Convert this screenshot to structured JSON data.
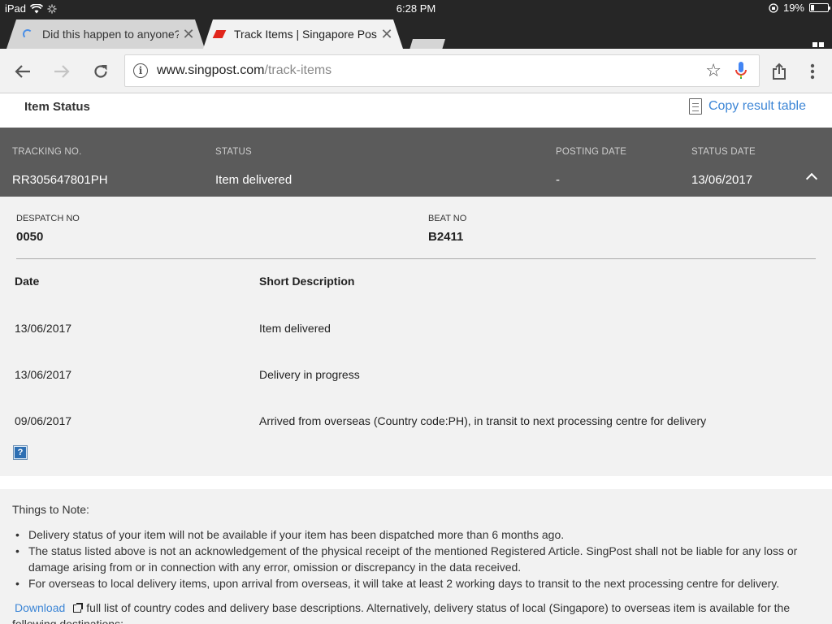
{
  "status_bar": {
    "device": "iPad",
    "time": "6:28 PM",
    "battery_percent": "19%",
    "battery_level": 0.19
  },
  "tabs": [
    {
      "title": "Did this happen to anyone? -",
      "loading": true
    },
    {
      "title": "Track Items | Singapore Post",
      "active": true
    }
  ],
  "toolbar": {
    "url_host": "www.singpost.com",
    "url_path": "/track-items"
  },
  "header": {
    "title": "Item Status",
    "copy_label": "Copy result table"
  },
  "result": {
    "columns": [
      "TRACKING NO.",
      "STATUS",
      "POSTING DATE",
      "STATUS DATE"
    ],
    "tracking_no": "RR305647801PH",
    "status": "Item delivered",
    "posting_date": "-",
    "status_date": "13/06/2017"
  },
  "details": {
    "despatch_label": "DESPATCH NO",
    "despatch_value": "0050",
    "beat_label": "BEAT NO",
    "beat_value": "B2411",
    "events_headers": [
      "Date",
      "Short Description"
    ],
    "events": [
      {
        "date": "13/06/2017",
        "desc": "Item delivered"
      },
      {
        "date": "13/06/2017",
        "desc": "Delivery in progress"
      },
      {
        "date": "09/06/2017",
        "desc": "Arrived from overseas (Country code:PH), in transit to next processing centre for delivery"
      }
    ]
  },
  "notes": {
    "title": "Things to Note:",
    "items": [
      "Delivery status of your item will not be available if your item has been dispatched more than 6 months ago.",
      "The status listed above is not an acknowledgement of the physical receipt of the mentioned Registered Article. SingPost shall not be liable for any loss or damage arising from or in connection with any error, omission or discrepancy in the data received.",
      "For overseas to local delivery items, upon arrival from overseas, it will take at least 2 working days to transit to the next processing centre for delivery."
    ],
    "download_label": "Download",
    "download_text": "full list of country codes and delivery base descriptions. Alternatively, delivery status of local (Singapore) to overseas item is available for the following destinations:"
  }
}
